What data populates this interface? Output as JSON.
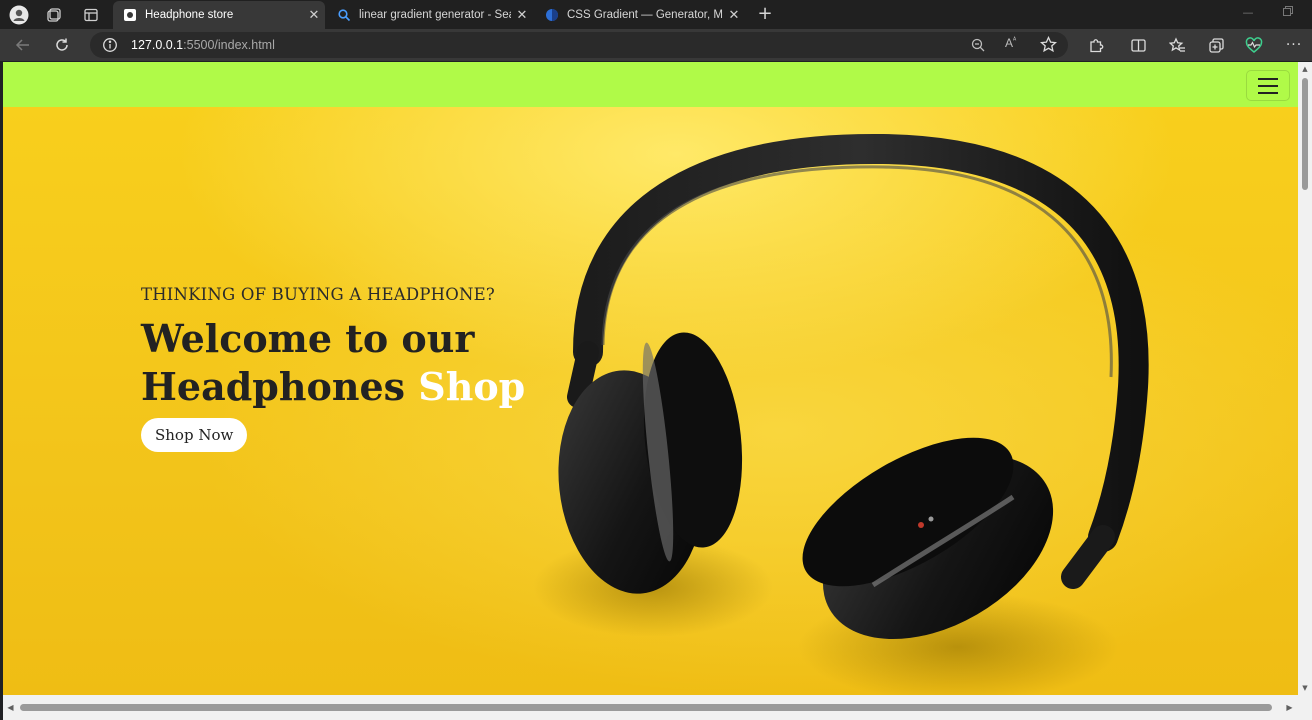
{
  "browser": {
    "tabs": [
      {
        "title": "Headphone store",
        "favicon": "page-icon",
        "active": true
      },
      {
        "title": "linear gradient generator - Search",
        "favicon": "search-icon",
        "active": false
      },
      {
        "title": "CSS Gradient — Generator, Maker",
        "favicon": "globe-icon",
        "active": false
      }
    ],
    "url": {
      "host": "127.0.0.1",
      "rest": ":5500/index.html"
    },
    "colors": {
      "tabbar": "#202020",
      "toolbar": "#383838"
    }
  },
  "page": {
    "navbar_color": "#b0fa48",
    "hero": {
      "eyebrow": "THINKING OF BUYING A HEADPHONE?",
      "headline_line1": "Welcome to our",
      "headline_line2": "Headphones",
      "headline_accent": "Shop",
      "cta_label": "Shop Now"
    },
    "colors": {
      "hero_yellow": "#f6c800",
      "accent_text": "#ffffff"
    }
  }
}
